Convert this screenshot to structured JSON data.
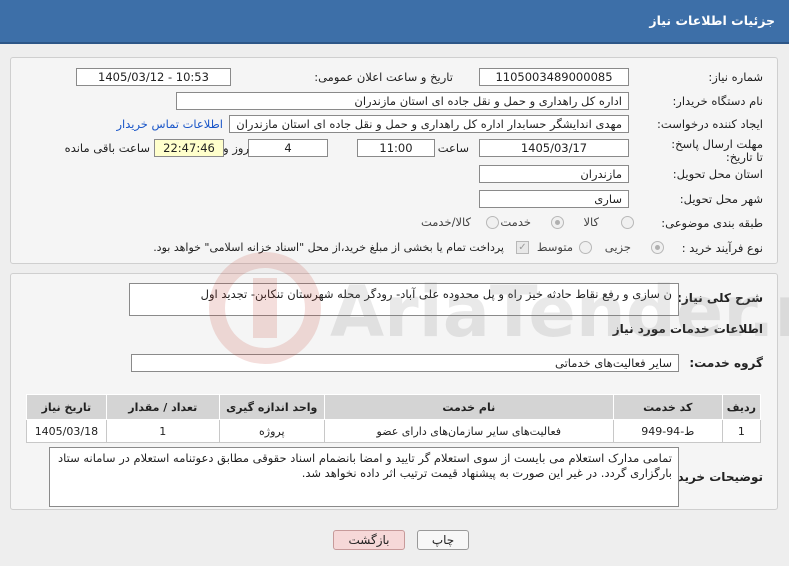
{
  "header": {
    "title": "جزئیات اطلاعات نیاز"
  },
  "form": {
    "need_number_label": "شماره نیاز:",
    "need_number": "1105003489000085",
    "announce_label": "تاریخ و ساعت اعلان عمومی:",
    "announce_value": "1405/03/12 - 10:53",
    "buyer_org_label": "نام دستگاه خریدار:",
    "buyer_org": "اداره کل راهداری و حمل و نقل جاده ای استان مازندران",
    "creator_label": "ایجاد کننده درخواست:",
    "creator": "مهدی اندایشگر حسابدار اداره کل راهداری و حمل و نقل جاده ای استان مازندران",
    "contact_link": "اطلاعات تماس خریدار",
    "deadline_label": "مهلت ارسال پاسخ: تا تاریخ:",
    "deadline_date": "1405/03/17",
    "time_label": "ساعت",
    "deadline_time": "11:00",
    "days_value": "4",
    "days_label": "روز و",
    "remaining_time": "22:47:46",
    "remaining_label": "ساعت باقی مانده",
    "province_label": "استان محل تحویل:",
    "province": "مازندران",
    "city_label": "شهر محل تحویل:",
    "city": "ساری",
    "category_label": "طبقه بندی موضوعی:",
    "category_options": [
      "کالا",
      "خدمت",
      "کالا/خدمت"
    ],
    "category_selected": "خدمت",
    "process_label": "نوع فرآیند خرید :",
    "process_options": [
      "جزیی",
      "متوسط"
    ],
    "process_selected": "جزیی",
    "payment_note": "پرداخت تمام یا بخشی از مبلغ خرید،از محل \"اسناد خزانه اسلامی\" خواهد بود."
  },
  "details": {
    "summary_label": "شرح کلی نیاز:",
    "summary": "ن سازی و رفع نقاط حادثه خیز راه و پل محدوده علی آباد- رودگر محله شهرستان تنکابن- تجدید اول",
    "services_heading": "اطلاعات خدمات مورد نیاز",
    "service_group_label": "گروه خدمت:",
    "service_group": "سایر فعالیت‌های خدماتی",
    "table": {
      "headers": [
        "ردیف",
        "کد خدمت",
        "نام خدمت",
        "واحد اندازه گیری",
        "تعداد / مقدار",
        "تاریخ نیاز"
      ],
      "rows": [
        [
          "1",
          "ط-94-949",
          "فعالیت‌های سایر سازمان‌های دارای عضو",
          "پروژه",
          "1",
          "1405/03/18"
        ]
      ]
    },
    "buyer_notes_label": "توضیحات خریدار:",
    "buyer_notes": "تمامی مدارک استعلام می بایست از سوی استعلام گر تایید و امضا بانضمام اسناد حقوقی مطابق دعوتنامه استعلام در سامانه ستاد بارگزاری گردد. در غیر این صورت به پیشنهاد قیمت ترتیب اثر داده نخواهد شد."
  },
  "buttons": {
    "print": "چاپ",
    "back": "بازگشت"
  },
  "watermark": {
    "text": "AriaTender.net"
  },
  "colors": {
    "header": "#3d6fa8",
    "link": "#1a56c8",
    "back_button": "#f6d8d8",
    "remaining_bg": "#ffffcc"
  }
}
